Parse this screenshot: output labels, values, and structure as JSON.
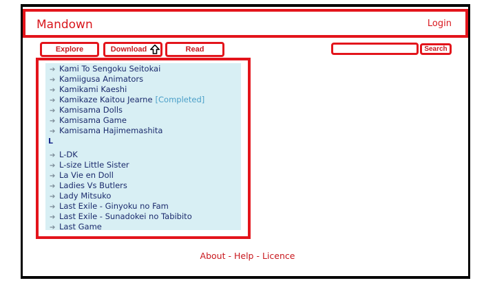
{
  "header": {
    "brand": "Mandown",
    "login": "Login"
  },
  "tabs": {
    "explore": "Explore",
    "download": "Download",
    "read": "Read"
  },
  "search": {
    "button": "Search",
    "value": ""
  },
  "list": {
    "group1": [
      {
        "title": "Kami To Sengoku Seitokai"
      },
      {
        "title": "Kamiigusa Animators"
      },
      {
        "title": "Kamikami Kaeshi"
      },
      {
        "title": "Kamikaze Kaitou Jearne",
        "tag": "[Completed]"
      },
      {
        "title": "Kamisama Dolls"
      },
      {
        "title": "Kamisama Game"
      },
      {
        "title": "Kamisama Hajimemashita"
      }
    ],
    "letter": "L",
    "group2": [
      {
        "title": "L-DK"
      },
      {
        "title": "L-size Little Sister"
      },
      {
        "title": "La Vie en Doll"
      },
      {
        "title": "Ladies Vs Butlers"
      },
      {
        "title": "Lady Mitsuko"
      },
      {
        "title": "Last Exile - Ginyoku no Fam"
      },
      {
        "title": "Last Exile - Sunadokei no Tabibito"
      },
      {
        "title": "Last Game"
      }
    ],
    "arrow_icon": "arrow-right-icon"
  },
  "footer": {
    "about": "About",
    "help": "Help",
    "licence": "Licence",
    "separator": " - "
  },
  "colors": {
    "accent": "#e3141b",
    "panel": "#d8eff4",
    "link": "#1a2a6c"
  }
}
